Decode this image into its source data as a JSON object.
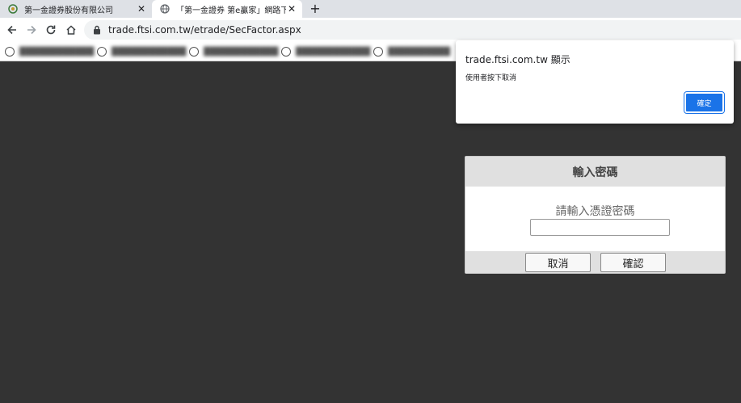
{
  "tabs": [
    {
      "title": "第一金證券股份有限公司",
      "active": false
    },
    {
      "title": "「第一金證券 第e贏家」網路下單",
      "active": true
    }
  ],
  "address_bar": {
    "url": "trade.ftsi.com.tw/etrade/SecFactor.aspx"
  },
  "alert": {
    "origin": "trade.ftsi.com.tw 顯示",
    "message": "使用者按下取消",
    "ok_label": "確定"
  },
  "panel": {
    "title": "輸入密碼",
    "prompt": "請輸入憑證密碼",
    "password_value": "",
    "cancel_label": "取消",
    "confirm_label": "確認"
  },
  "colors": {
    "page_background": "#333333",
    "accent": "#1a73e8",
    "panel_header": "#e0e0e0"
  }
}
